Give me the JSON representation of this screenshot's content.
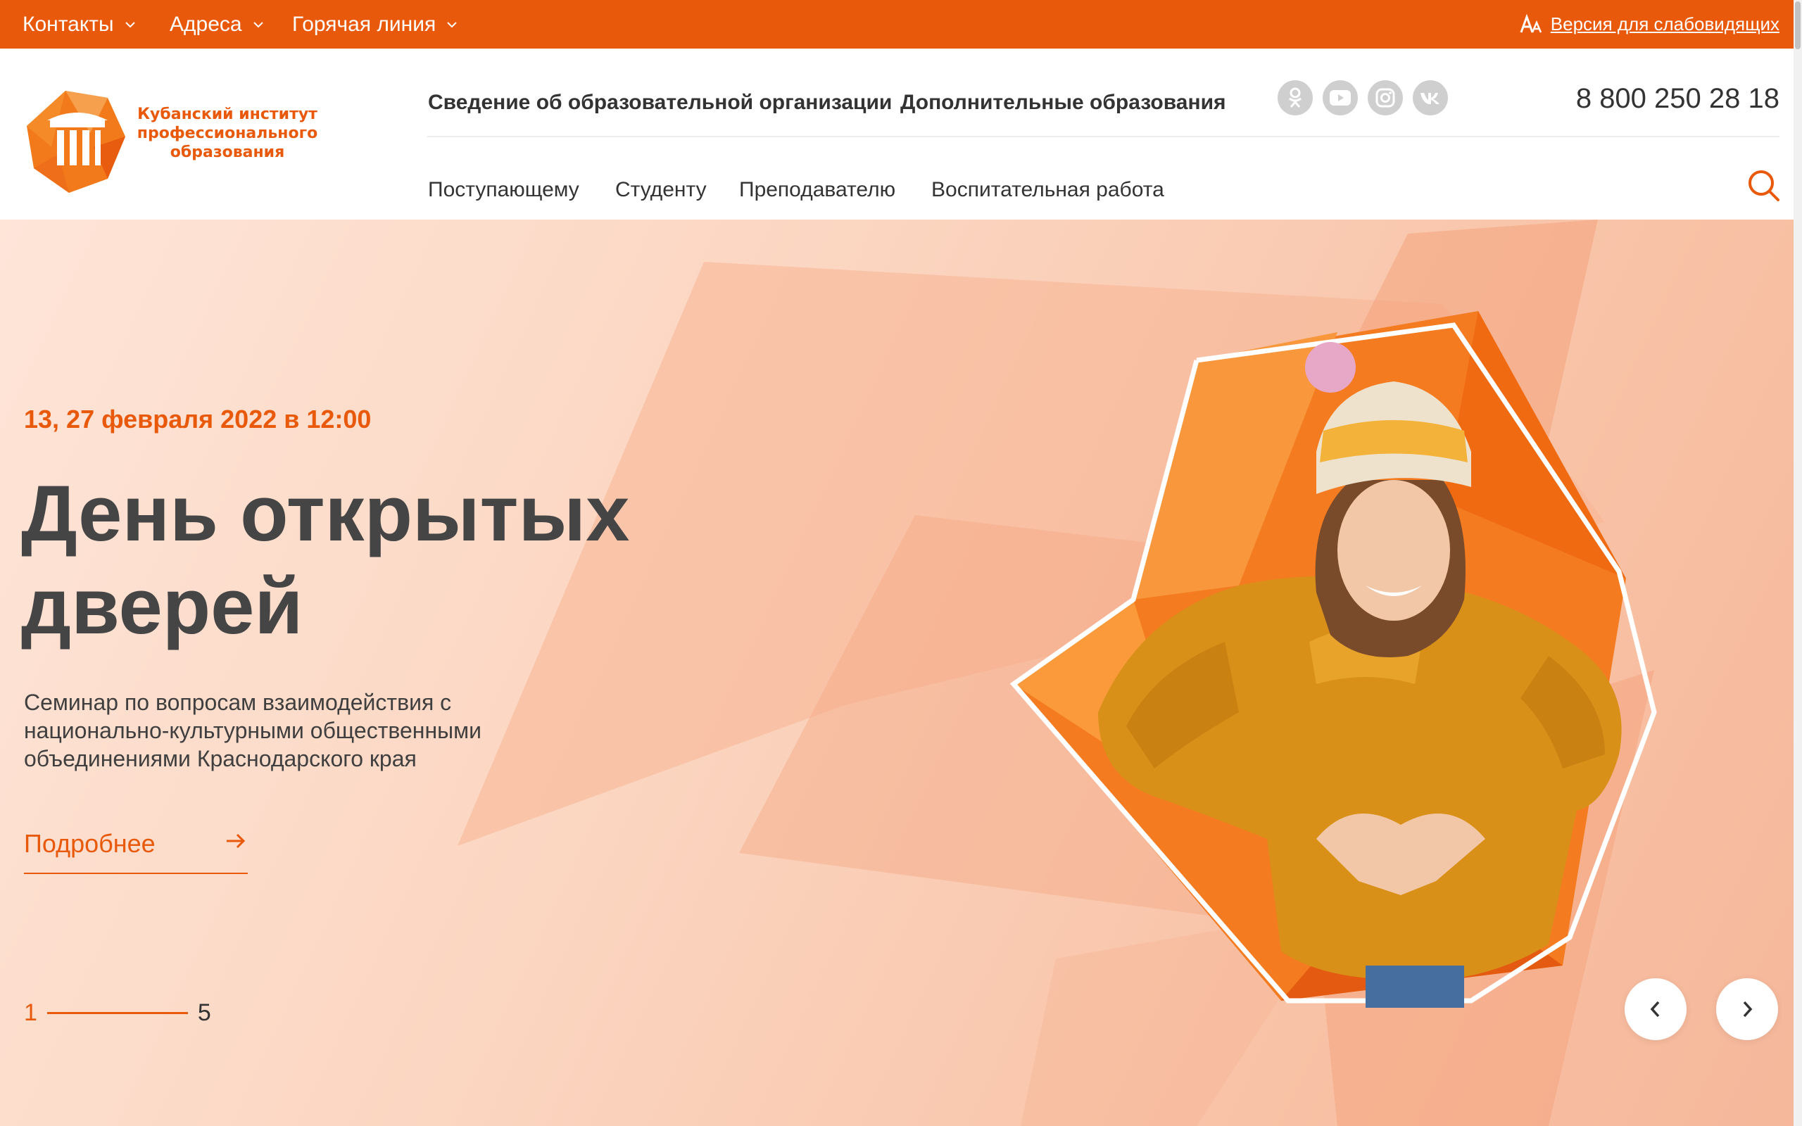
{
  "topbar": {
    "menu": [
      {
        "label": "Контакты"
      },
      {
        "label": "Адреса"
      },
      {
        "label": "Горячая линия"
      }
    ],
    "accessibility_label": "Версия для слабовидящих"
  },
  "header": {
    "logo_text": "Кубанский институт профессионального образования",
    "nav_primary": [
      {
        "label": "Сведение об образовательной организации"
      },
      {
        "label": "Дополнительные образования"
      }
    ],
    "social_icons": [
      "odnoklassniki-icon",
      "youtube-icon",
      "instagram-icon",
      "vk-icon"
    ],
    "phone": "8 800 250 28 18",
    "nav_secondary": [
      {
        "label": "Поступающему"
      },
      {
        "label": "Студенту"
      },
      {
        "label": "Преподавателю"
      },
      {
        "label": "Воспитательная работа"
      }
    ]
  },
  "hero": {
    "date": "13, 27 февраля 2022 в 12:00",
    "title_line1": "День открытых",
    "title_line2": "дверей",
    "description": "Семинар по вопросам взаимодействия с национально-культурными общественными объединениями Краснодарского края",
    "more_label": "Подробнее",
    "pager_current": "1",
    "pager_total": "5"
  },
  "colors": {
    "accent": "#e8590c",
    "text_dark": "#454545",
    "social_bg": "#cfcfcf"
  }
}
